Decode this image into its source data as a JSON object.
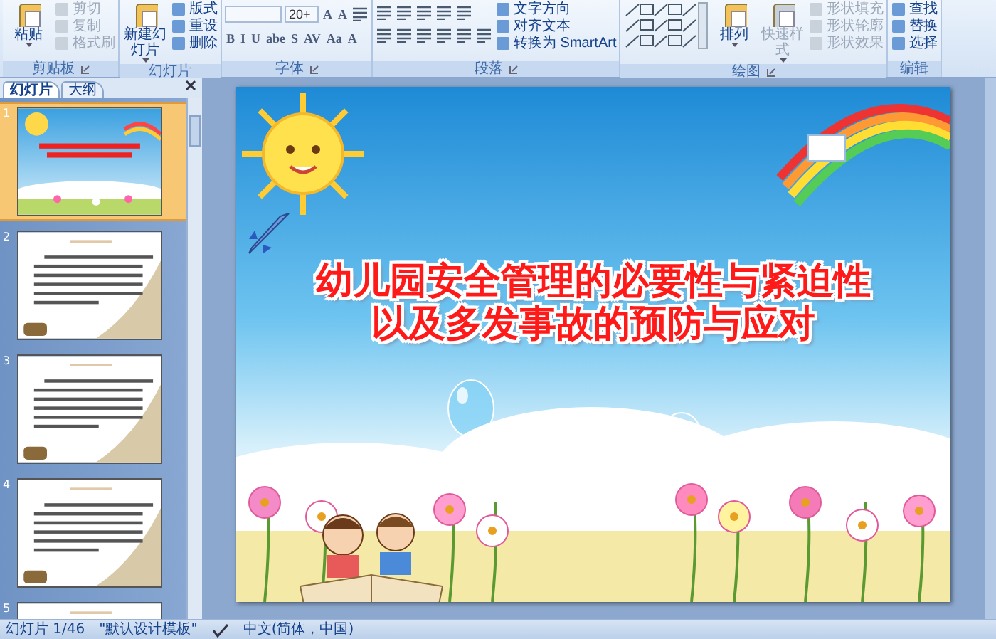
{
  "ribbon": {
    "groups": [
      {
        "label": "剪贴板",
        "launcher": true,
        "sections": [
          {
            "kind": "large",
            "label": "粘贴",
            "dropdown": true,
            "disabled": false
          },
          {
            "kind": "column",
            "items": [
              {
                "label": "剪切",
                "disabled": true
              },
              {
                "label": "复制",
                "disabled": true
              },
              {
                "label": "格式刷",
                "disabled": true
              }
            ]
          }
        ]
      },
      {
        "label": "幻灯片",
        "launcher": false,
        "sections": [
          {
            "kind": "large",
            "label": "新建幻灯片",
            "dropdown": true,
            "disabled": false
          },
          {
            "kind": "column",
            "items": [
              {
                "label": "版式",
                "disabled": false
              },
              {
                "label": "重设",
                "disabled": false
              },
              {
                "label": "删除",
                "disabled": false
              }
            ]
          }
        ]
      },
      {
        "label": "字体",
        "launcher": true,
        "sections": [
          {
            "kind": "toolbars",
            "toolbars": [
              {
                "items": [
                  {
                    "kind": "field"
                  },
                  {
                    "kind": "field",
                    "value": "20+"
                  },
                  {
                    "kind": "glyph",
                    "label": "A"
                  },
                  {
                    "kind": "glyph",
                    "label": "A"
                  },
                  {
                    "kind": "icon"
                  }
                ]
              },
              {
                "items": [
                  {
                    "kind": "glyph",
                    "label": "B"
                  },
                  {
                    "kind": "glyph",
                    "label": "I"
                  },
                  {
                    "kind": "glyph",
                    "label": "U"
                  },
                  {
                    "kind": "glyph",
                    "label": "abe"
                  },
                  {
                    "kind": "glyph",
                    "label": "S"
                  },
                  {
                    "kind": "glyph",
                    "label": "AV"
                  },
                  {
                    "kind": "glyph",
                    "label": "Aa"
                  },
                  {
                    "kind": "glyph",
                    "label": "A"
                  }
                ]
              }
            ]
          }
        ]
      },
      {
        "label": "段落",
        "launcher": true,
        "sections": [
          {
            "kind": "toolbars",
            "toolbars": [
              {
                "items": [
                  {
                    "kind": "icon"
                  },
                  {
                    "kind": "icon"
                  },
                  {
                    "kind": "icon"
                  },
                  {
                    "kind": "icon"
                  },
                  {
                    "kind": "icon"
                  }
                ]
              },
              {
                "items": [
                  {
                    "kind": "icon"
                  },
                  {
                    "kind": "icon"
                  },
                  {
                    "kind": "icon"
                  },
                  {
                    "kind": "icon"
                  },
                  {
                    "kind": "icon"
                  },
                  {
                    "kind": "icon"
                  }
                ]
              }
            ]
          },
          {
            "kind": "column",
            "items": [
              {
                "label": "文字方向",
                "disabled": false
              },
              {
                "label": "对齐文本",
                "disabled": false
              },
              {
                "label": "转换为 SmartArt",
                "disabled": false
              }
            ]
          }
        ]
      },
      {
        "label": "绘图",
        "launcher": true,
        "sections": [
          {
            "kind": "gallery"
          },
          {
            "kind": "large",
            "label": "排列",
            "dropdown": true,
            "disabled": false
          },
          {
            "kind": "large",
            "label": "快速样式",
            "dropdown": true,
            "disabled": true
          },
          {
            "kind": "column",
            "items": [
              {
                "label": "形状填充",
                "disabled": true
              },
              {
                "label": "形状轮廓",
                "disabled": true
              },
              {
                "label": "形状效果",
                "disabled": true
              }
            ]
          }
        ]
      },
      {
        "label": "编辑",
        "launcher": false,
        "sections": [
          {
            "kind": "column",
            "items": [
              {
                "label": "查找",
                "disabled": false
              },
              {
                "label": "替换",
                "disabled": false
              },
              {
                "label": "选择",
                "disabled": false
              }
            ]
          }
        ]
      }
    ]
  },
  "panel": {
    "tabs": [
      {
        "label": "幻灯片",
        "selected": true
      },
      {
        "label": "大纲",
        "selected": false
      }
    ],
    "thumbnails": [
      {
        "number": "1",
        "kind": "title",
        "selected": true
      },
      {
        "number": "2",
        "kind": "text",
        "selected": false
      },
      {
        "number": "3",
        "kind": "text",
        "selected": false
      },
      {
        "number": "4",
        "kind": "text",
        "selected": false
      },
      {
        "number": "5",
        "kind": "text",
        "selected": false
      }
    ]
  },
  "slide": {
    "title_lines": [
      "幼儿园安全管理的必要性与紧迫性",
      "以及多发事故的预防与应对"
    ]
  },
  "status_bar": {
    "slide": "幻灯片 1/46",
    "theme": "\"默认设计模板\"",
    "language": "中文(简体，中国)"
  }
}
